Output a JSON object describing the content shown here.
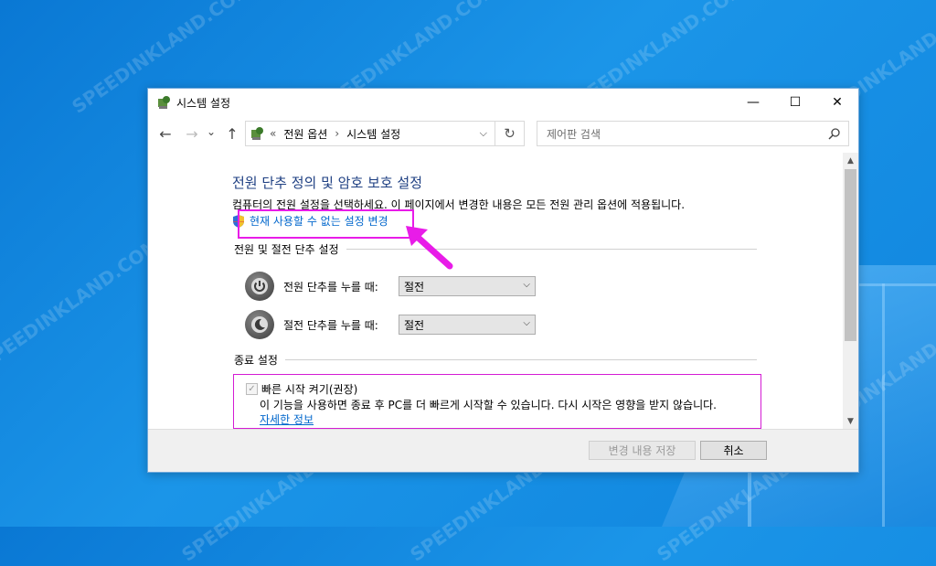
{
  "colors": {
    "accent_title": "#1e3f82",
    "link": "#0066cc",
    "highlight": "#e81ce8",
    "desktop": "#0a78d4"
  },
  "watermark": "SPEEDINKLAND.COM",
  "window": {
    "title": "시스템 설정",
    "controls": {
      "minimize": "—",
      "maximize": "☐",
      "close": "✕"
    }
  },
  "nav": {
    "back_icon": "←",
    "forward_icon": "→",
    "recent_icon": "⌄",
    "up_icon": "↑",
    "address": {
      "prefix": "«",
      "crumbs": [
        "전원 옵션",
        "시스템 설정"
      ],
      "separator": "›"
    },
    "refresh_icon": "↻",
    "search_placeholder": "제어판 검색"
  },
  "main": {
    "title": "전원 단추 정의 및 암호 보호 설정",
    "description": "컴퓨터의 전원 설정을 선택하세요. 이 페이지에서 변경한 내용은 모든 전원 관리 옵션에 적용됩니다.",
    "change_link": "현재 사용할 수 없는 설정 변경",
    "power_section": {
      "title": "전원 및 절전 단추 설정",
      "rows": [
        {
          "label": "전원 단추를 누를 때:",
          "value": "절전",
          "icon": "power-icon"
        },
        {
          "label": "절전 단추를 누를 때:",
          "value": "절전",
          "icon": "sleep-icon"
        }
      ]
    },
    "shutdown_section": {
      "title": "종료 설정",
      "fast_startup": {
        "label": "빠른 시작 켜기(권장)",
        "checked": true,
        "description": "이 기능을 사용하면 종료 후 PC를 더 빠르게 시작할 수 있습니다. 다시 시작은 영향을 받지 않습니다.",
        "more_link": "자세한 정보"
      }
    }
  },
  "footer": {
    "save_label": "변경 내용 저장",
    "cancel_label": "취소"
  }
}
